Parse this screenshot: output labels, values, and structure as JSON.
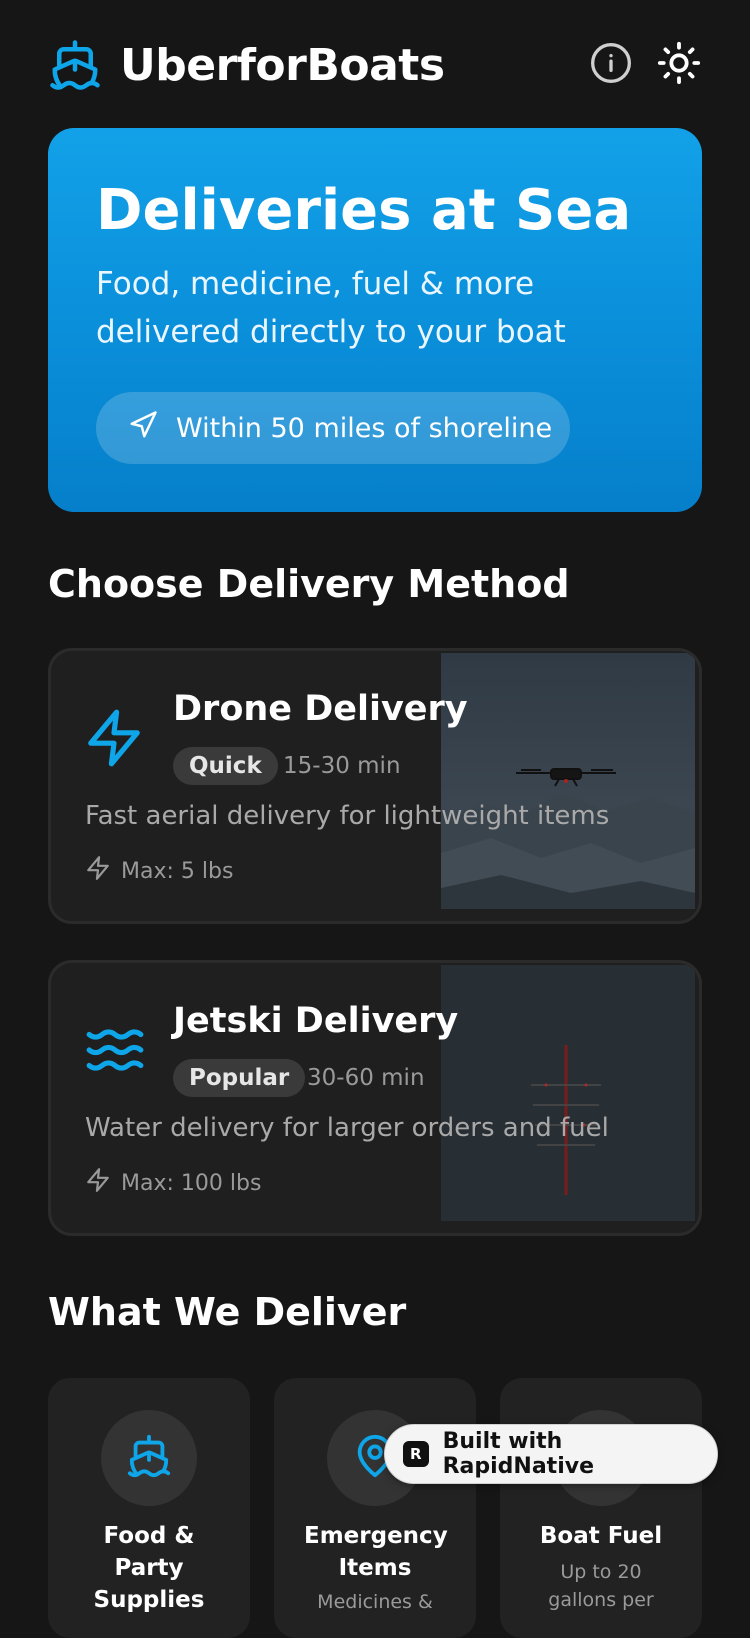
{
  "header": {
    "app_name": "UberforBoats",
    "logo_icon": "ship-icon",
    "info_icon": "info-icon",
    "theme_icon": "sun-icon",
    "accent_color": "#0ea5e9"
  },
  "hero": {
    "title": "Deliveries at Sea",
    "subtitle": "Food, medicine, fuel & more delivered directly to your boat",
    "range_pill": "Within 50 miles of shoreline",
    "range_icon": "navigation-arrow-icon"
  },
  "methods_section": {
    "title": "Choose Delivery Method",
    "items": [
      {
        "name": "Drone Delivery",
        "icon": "lightning-icon",
        "badge": "Quick",
        "eta": "15-30 min",
        "description": "Fast aerial delivery for lightweight items",
        "max_weight": "Max: 5 lbs",
        "image": "drone-over-mountains-photo"
      },
      {
        "name": "Jetski Delivery",
        "icon": "waves-icon",
        "badge": "Popular",
        "eta": "30-60 min",
        "description": "Water delivery for larger orders and fuel",
        "max_weight": "Max: 100 lbs",
        "image": "rowing-boat-aerial-photo"
      }
    ]
  },
  "deliver_section": {
    "title": "What We Deliver",
    "items": [
      {
        "title": "Food & Party Supplies",
        "subtitle": "",
        "icon": "ship-icon"
      },
      {
        "title": "Emergency Items",
        "subtitle": "Medicines &",
        "icon": "map-pin-icon"
      },
      {
        "title": "Boat Fuel",
        "subtitle": "Up to 20 gallons per",
        "icon": "fuel-icon"
      }
    ]
  },
  "built_with": {
    "label": "Built with RapidNative",
    "logo_letter": "R"
  }
}
